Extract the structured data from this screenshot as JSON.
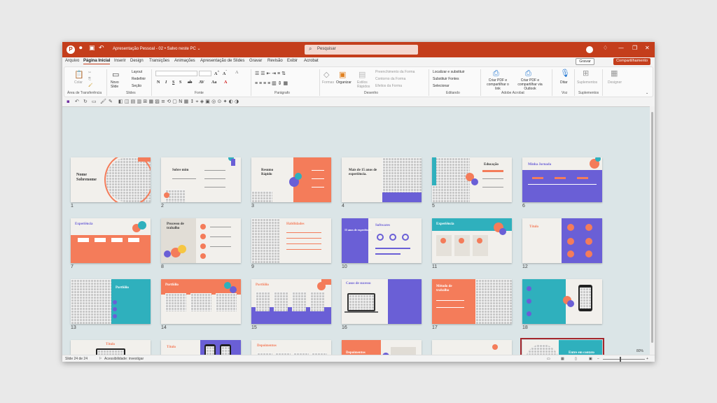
{
  "titlebar": {
    "logo": "P",
    "doc_title": "Apresentação Pessoal - 02  •  Salvo neste PC ⌄",
    "search_placeholder": "Pesquisar"
  },
  "tabs": [
    "Arquivo",
    "Página Inicial",
    "Inserir",
    "Design",
    "Transições",
    "Animações",
    "Apresentação de Slides",
    "Gravar",
    "Revisão",
    "Exibir",
    "Acrobat"
  ],
  "gravar_label": "Gravar",
  "share_label": "Compartilhamento",
  "ribbon": {
    "groups": [
      "Área de Transferência",
      "Slides",
      "Fonte",
      "Parágrafo",
      "Desenho",
      "Editando",
      "Adobe Acrobat",
      "Voz",
      "Suplementos"
    ],
    "colar": "Colar",
    "novo_slide": "Novo Slide",
    "layout": "Layout",
    "redefinir": "Redefinir",
    "secao": "Seção",
    "formas": "Formas",
    "organizar": "Organizar",
    "estilos_rapidos": "Estilos Rápidos",
    "preenchimento": "Preenchimento da Forma",
    "contorno": "Contorno da Forma",
    "efeitos": "Efeitos da Forma",
    "localizar": "Localizar e substituir",
    "substituir_fontes": "Substituir Fontes",
    "selecionar": "Selecionar",
    "criar_pdf": "Criar PDF e compartilhar o link",
    "criar_pdf_outlook": "Criar PDF e compartilhar via Outlook",
    "ditar": "Ditar",
    "suplementos": "Suplementos",
    "designer": "Designer"
  },
  "slides": [
    {
      "n": "1",
      "title": "Nome Sobrenome"
    },
    {
      "n": "2",
      "title": "Sobre mim"
    },
    {
      "n": "3",
      "title": "Resumo Rápido"
    },
    {
      "n": "4",
      "title": "Mais de 15 anos de experiência."
    },
    {
      "n": "5",
      "title": "Educação"
    },
    {
      "n": "6",
      "title": "Minha Jornada"
    },
    {
      "n": "7",
      "title": "Experiência"
    },
    {
      "n": "8",
      "title": "Processo de trabalho"
    },
    {
      "n": "9",
      "title": "Habilidades"
    },
    {
      "n": "10",
      "title": "Softwares"
    },
    {
      "n": "11",
      "title": "Experiência"
    },
    {
      "n": "12",
      "title": "Título"
    },
    {
      "n": "13",
      "title": "Portfólio"
    },
    {
      "n": "14",
      "title": "Portfólio"
    },
    {
      "n": "15",
      "title": "Portfólio"
    },
    {
      "n": "16",
      "title": "Casos de sucesso"
    },
    {
      "n": "17",
      "title": "Método de trabalho"
    },
    {
      "n": "18",
      "title": ""
    },
    {
      "n": "19",
      "title": "Título"
    },
    {
      "n": "20",
      "title": "Título"
    },
    {
      "n": "21",
      "title": "Depoimentos"
    },
    {
      "n": "22",
      "title": "Depoimentos"
    },
    {
      "n": "23",
      "title": ""
    },
    {
      "n": "24",
      "title": "Entre em contato comigo!"
    }
  ],
  "slide10_extra": "15 anos de experiência",
  "status": {
    "slide_count": "Slide 24 de 24",
    "accessibility": "Acessibilidade: investigar",
    "zoom": "80%"
  },
  "colors": {
    "orange": "#f47c5a",
    "purple": "#6a5fd6",
    "teal": "#2fb0bd",
    "yellow": "#f6c642",
    "brand": "#c43e1c"
  }
}
